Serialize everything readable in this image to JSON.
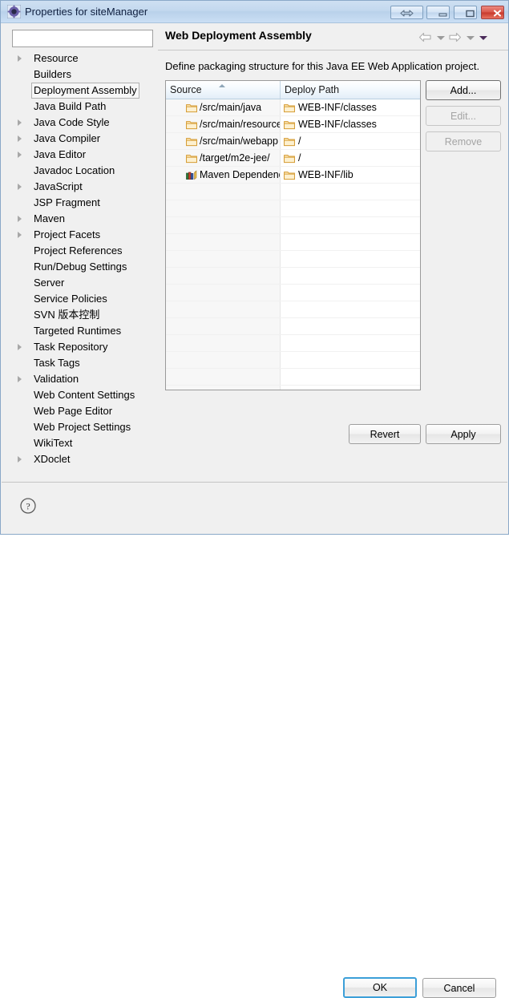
{
  "window": {
    "title": "Properties for siteManager",
    "icon": "gear-icon",
    "controls": {
      "help": "resize-arrows-icon",
      "minimize": "minimize-icon",
      "maximize": "maximize-icon",
      "close": "close-icon"
    }
  },
  "filter": {
    "value": "",
    "placeholder": ""
  },
  "sidebar": {
    "items": [
      {
        "label": "Resource",
        "expandable": true,
        "selected": false
      },
      {
        "label": "Builders",
        "expandable": false,
        "selected": false
      },
      {
        "label": "Deployment Assembly",
        "expandable": false,
        "selected": true
      },
      {
        "label": "Java Build Path",
        "expandable": false,
        "selected": false
      },
      {
        "label": "Java Code Style",
        "expandable": true,
        "selected": false
      },
      {
        "label": "Java Compiler",
        "expandable": true,
        "selected": false
      },
      {
        "label": "Java Editor",
        "expandable": true,
        "selected": false
      },
      {
        "label": "Javadoc Location",
        "expandable": false,
        "selected": false
      },
      {
        "label": "JavaScript",
        "expandable": true,
        "selected": false
      },
      {
        "label": "JSP Fragment",
        "expandable": false,
        "selected": false
      },
      {
        "label": "Maven",
        "expandable": true,
        "selected": false
      },
      {
        "label": "Project Facets",
        "expandable": true,
        "selected": false
      },
      {
        "label": "Project References",
        "expandable": false,
        "selected": false
      },
      {
        "label": "Run/Debug Settings",
        "expandable": false,
        "selected": false
      },
      {
        "label": "Server",
        "expandable": false,
        "selected": false
      },
      {
        "label": "Service Policies",
        "expandable": false,
        "selected": false
      },
      {
        "label": "SVN 版本控制",
        "expandable": false,
        "selected": false
      },
      {
        "label": "Targeted Runtimes",
        "expandable": false,
        "selected": false
      },
      {
        "label": "Task Repository",
        "expandable": true,
        "selected": false
      },
      {
        "label": "Task Tags",
        "expandable": false,
        "selected": false
      },
      {
        "label": "Validation",
        "expandable": true,
        "selected": false
      },
      {
        "label": "Web Content Settings",
        "expandable": false,
        "selected": false
      },
      {
        "label": "Web Page Editor",
        "expandable": false,
        "selected": false
      },
      {
        "label": "Web Project Settings",
        "expandable": false,
        "selected": false
      },
      {
        "label": "WikiText",
        "expandable": false,
        "selected": false
      },
      {
        "label": "XDoclet",
        "expandable": true,
        "selected": false
      }
    ]
  },
  "panel": {
    "title": "Web Deployment Assembly",
    "description": "Define packaging structure for this Java EE Web Application project.",
    "nav": {
      "back": "back-arrow-icon",
      "back_menu": "chevron-down-icon",
      "forward": "forward-arrow-icon",
      "forward_menu": "chevron-down-icon",
      "view_menu": "chevron-down-icon"
    }
  },
  "table": {
    "columns": [
      {
        "label": "Source",
        "sort": "ascending"
      },
      {
        "label": "Deploy Path",
        "sort": ""
      }
    ],
    "rows": [
      {
        "source": "/src/main/java",
        "source_icon": "folder-icon",
        "deploy": "WEB-INF/classes",
        "deploy_icon": "folder-icon"
      },
      {
        "source": "/src/main/resources",
        "source_icon": "folder-icon",
        "deploy": "WEB-INF/classes",
        "deploy_icon": "folder-icon"
      },
      {
        "source": "/src/main/webapp",
        "source_icon": "folder-icon",
        "deploy": "/",
        "deploy_icon": "folder-icon"
      },
      {
        "source": "/target/m2e-jee/",
        "source_icon": "folder-icon",
        "deploy": "/",
        "deploy_icon": "folder-icon"
      },
      {
        "source": "Maven Dependencies",
        "source_icon": "library-icon",
        "deploy": "WEB-INF/lib",
        "deploy_icon": "folder-icon"
      }
    ],
    "empty_row_count": 17
  },
  "buttons": {
    "add": "Add...",
    "edit": "Edit...",
    "remove": "Remove",
    "revert": "Revert",
    "apply": "Apply",
    "ok": "OK",
    "cancel": "Cancel"
  },
  "footer": {
    "help": "help-icon"
  },
  "colors": {
    "titlebar": "#c3d8ee",
    "dialog_bg": "#f0f0f0",
    "close_button": "#c6392c",
    "focus_ring": "#3c9fd8",
    "folder_icon": "#f5c678",
    "header_gradient": "#e3eef8"
  }
}
